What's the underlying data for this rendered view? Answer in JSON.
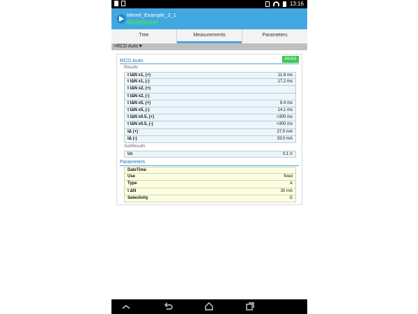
{
  "status": {
    "time": "13:16"
  },
  "app": {
    "title": "Metrel_Example_2_1",
    "subtitle": "MultiMeter"
  },
  "tabs": [
    {
      "label": "Tree"
    },
    {
      "label": "Measurements"
    },
    {
      "label": "Parameters"
    }
  ],
  "breadcrumb": ">RCD Auto▼",
  "card": {
    "title": "RCD Auto",
    "status": "PASS",
    "results_label": "Results",
    "results": [
      {
        "k": "t IΔN x1, (+)",
        "v": "11.6 ms"
      },
      {
        "k": "t IΔN x1, (-)",
        "v": "17.2 ms"
      },
      {
        "k": "t IΔN x2, (+)",
        "v": ""
      },
      {
        "k": "t IΔN x2, (-)",
        "v": ""
      },
      {
        "k": "t IΔN x5, (+)",
        "v": "8.4 ms"
      },
      {
        "k": "t IΔN x5, (-)",
        "v": "14.1 ms"
      },
      {
        "k": "t IΔN x0.5, (+)",
        "v": ">300 ms"
      },
      {
        "k": "t IΔN x0.5, (-)",
        "v": ">300 ms"
      },
      {
        "k": "IΔ (+)",
        "v": "27.0 mA"
      },
      {
        "k": "IΔ (-)",
        "v": "33.0 mA"
      }
    ],
    "subresults_label": "SubResults",
    "subresults": [
      {
        "k": "Uc",
        "v": "0.1 V"
      }
    ],
    "parameters_label": "Parameters",
    "parameters": [
      {
        "k": "DateTime",
        "v": ""
      },
      {
        "k": "Use",
        "v": "fixed"
      },
      {
        "k": "Type",
        "v": "A"
      },
      {
        "k": "t ΔN",
        "v": "30 mA"
      },
      {
        "k": "Selectivity",
        "v": "G"
      }
    ]
  },
  "colors": {
    "appbar": "#42a7e0",
    "pass": "#3cc94a",
    "title": "#1b6fb5"
  },
  "icons": [
    "notification-icon",
    "image-icon",
    "signal-icon",
    "wifi-icon",
    "battery-icon",
    "app-logo-icon",
    "chevron-up-icon",
    "back-icon",
    "home-icon",
    "recents-icon"
  ]
}
